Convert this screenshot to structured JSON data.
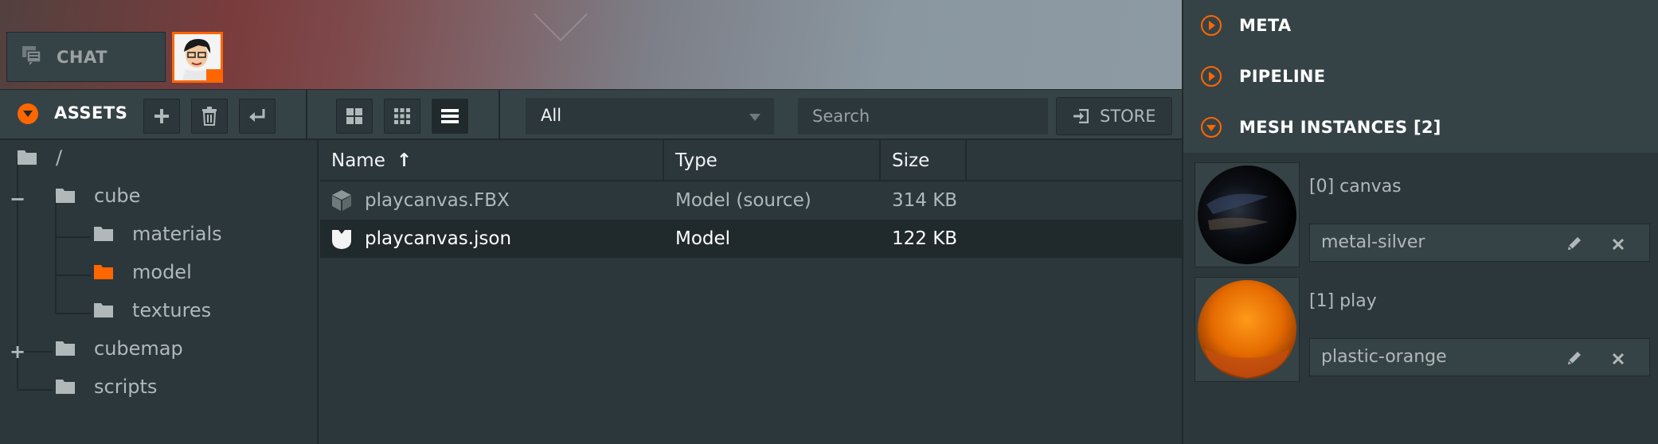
{
  "viewport": {
    "chat_label": "CHAT"
  },
  "assets": {
    "title": "ASSETS",
    "filter_value": "All",
    "search_placeholder": "Search",
    "store_label": "STORE"
  },
  "tree": {
    "root": "/",
    "items": [
      "cube",
      "materials",
      "model",
      "textures",
      "cubemap",
      "scripts"
    ],
    "toggles": {
      "cube": "−",
      "cubemap": "+"
    }
  },
  "table": {
    "columns": [
      "Name",
      "Type",
      "Size"
    ],
    "sort_indicator": "↑",
    "rows": [
      {
        "name": "playcanvas.FBX",
        "type": "Model (source)",
        "size": "314 KB",
        "icon": "cube-icon"
      },
      {
        "name": "playcanvas.json",
        "type": "Model",
        "size": "122 KB",
        "icon": "model-icon"
      }
    ]
  },
  "inspector": {
    "panels": [
      "META",
      "PIPELINE",
      "MESH INSTANCES [2]"
    ],
    "mesh_instances": [
      {
        "label": "[0] canvas",
        "material": "metal-silver"
      },
      {
        "label": "[1] play",
        "material": "plastic-orange"
      }
    ]
  },
  "colors": {
    "accent": "#ff6600",
    "bg": "#2b373b",
    "bg_header": "#364346",
    "border": "#20292b",
    "text": "#b1b8ba",
    "text_bright": "#f4f4f4"
  }
}
